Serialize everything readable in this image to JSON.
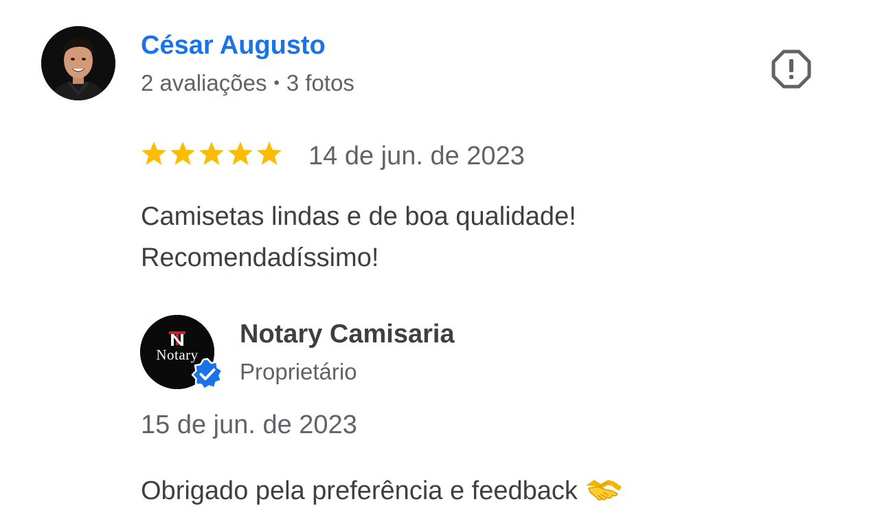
{
  "review": {
    "reviewer_name": "César Augusto",
    "reviewer_reviews": "2 avaliações",
    "separator": "•",
    "reviewer_photos": "3 fotos",
    "rating": 5,
    "max_rating": 5,
    "date": "14 de jun. de 2023",
    "text_lines": [
      "Camisetas lindas e de boa qualidade!",
      "Recomendadíssimo!"
    ]
  },
  "reply": {
    "owner_name": "Notary Camisaria",
    "owner_logo_text": "Notary",
    "owner_role": "Proprietário",
    "date": "15 de jun. de 2023",
    "text": "Obrigado pela preferência e feedback"
  },
  "icons": {
    "report": "report-flag-icon",
    "star": "star-icon",
    "verified": "verified-badge-icon",
    "handshake": "handshake-emoji-icon"
  },
  "colors": {
    "reviewer_name": "#1a73e8",
    "star": "#fbbc04",
    "verified": "#1a73e8",
    "text": "#3c4043",
    "muted": "#5f6368"
  }
}
